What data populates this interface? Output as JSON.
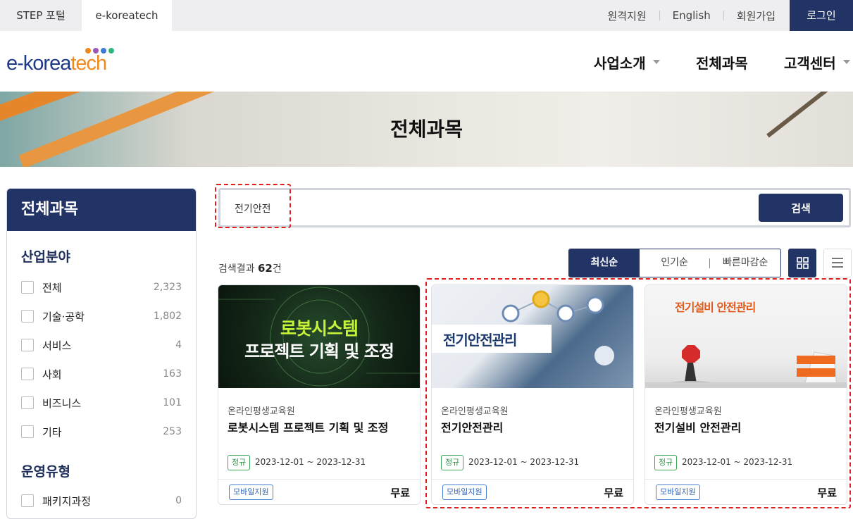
{
  "topbar": {
    "tabs": [
      "STEP 포털",
      "e-koreatech"
    ],
    "links": [
      "원격지원",
      "English",
      "회원가입"
    ],
    "login": "로그인"
  },
  "logo": {
    "part1": "e-korea",
    "part2": "tech",
    "dot_colors": [
      "#f28a1b",
      "#9b59b6",
      "#3a7bd5",
      "#2eb67d"
    ]
  },
  "nav": [
    {
      "label": "사업소개",
      "dropdown": true
    },
    {
      "label": "전체과목",
      "dropdown": false
    },
    {
      "label": "고객센터",
      "dropdown": true
    }
  ],
  "banner": {
    "title": "전체과목"
  },
  "sidebar": {
    "title": "전체과목",
    "section1": "산업분야",
    "items": [
      {
        "label": "전체",
        "count": "2,323"
      },
      {
        "label": "기술·공학",
        "count": "1,802"
      },
      {
        "label": "서비스",
        "count": "4"
      },
      {
        "label": "사회",
        "count": "163"
      },
      {
        "label": "비즈니스",
        "count": "101"
      },
      {
        "label": "기타",
        "count": "253"
      }
    ],
    "section2": "운영유형",
    "items2": [
      {
        "label": "패키지과정",
        "count": "0"
      }
    ]
  },
  "search": {
    "value": "전기안전",
    "button": "검색"
  },
  "results": {
    "prefix": "검색결과",
    "count": "62",
    "suffix": "건"
  },
  "sort": {
    "options": [
      "최신순",
      "인기순",
      "빠른마감순"
    ],
    "active": "최신순"
  },
  "cards": [
    {
      "provider": "온라인평생교육원",
      "title": "로봇시스템 프로젝트 기획 및 조정",
      "thumb_line1": "로봇시스템",
      "thumb_line2": "프로젝트 기획 및 조정",
      "badge": "정규",
      "period": "2023-12-01 ~ 2023-12-31",
      "mobile": "모바일지원",
      "price": "무료"
    },
    {
      "provider": "온라인평생교육원",
      "title": "전기안전관리",
      "thumb_title": "전기안전관리",
      "badge": "정규",
      "period": "2023-12-01 ~ 2023-12-31",
      "mobile": "모바일지원",
      "price": "무료"
    },
    {
      "provider": "온라인평생교육원",
      "title": "전기설비 안전관리",
      "thumb_title": "전기설비 안전관리",
      "badge": "정규",
      "period": "2023-12-01 ~ 2023-12-31",
      "mobile": "모바일지원",
      "price": "무료"
    }
  ],
  "colors": {
    "primary": "#223366",
    "accent": "#f28a1b",
    "highlight": "#e02020"
  }
}
